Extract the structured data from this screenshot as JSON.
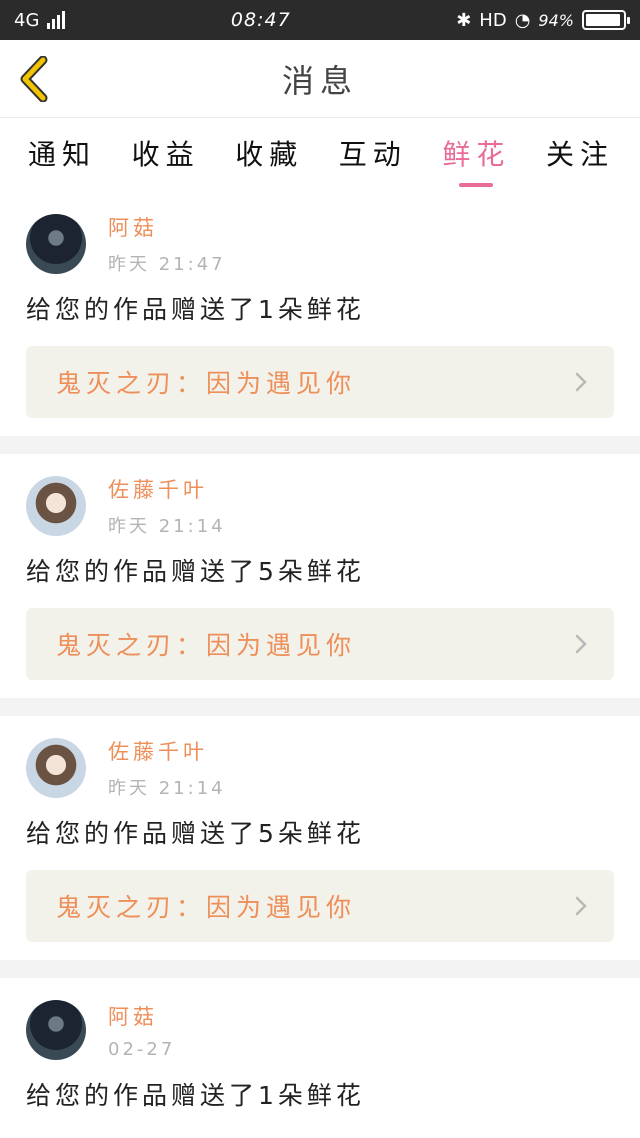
{
  "status": {
    "network": "4G",
    "time": "08:47",
    "hd": "HD",
    "battery_text": "94%",
    "battery_level": 0.94
  },
  "header": {
    "title": "消息"
  },
  "tabs": [
    {
      "label": "通知",
      "active": false
    },
    {
      "label": "收益",
      "active": false
    },
    {
      "label": "收藏",
      "active": false
    },
    {
      "label": "互动",
      "active": false
    },
    {
      "label": "鲜花",
      "active": true
    },
    {
      "label": "关注",
      "active": false
    }
  ],
  "messages": [
    {
      "user": "阿菇",
      "time": "昨天  21:47",
      "text": "给您的作品赠送了1朵鲜花",
      "work": "鬼灭之刃：因为遇见你",
      "avatar": "dark-hair-avatar"
    },
    {
      "user": "佐藤千叶",
      "time": "昨天  21:14",
      "text": "给您的作品赠送了5朵鲜花",
      "work": "鬼灭之刃：因为遇见你",
      "avatar": "light-hair-avatar"
    },
    {
      "user": "佐藤千叶",
      "time": "昨天  21:14",
      "text": "给您的作品赠送了5朵鲜花",
      "work": "鬼灭之刃：因为遇见你",
      "avatar": "light-hair-avatar"
    },
    {
      "user": "阿菇",
      "time": "02-27",
      "text": "给您的作品赠送了1朵鲜花",
      "avatar": "dark-hair-avatar"
    }
  ],
  "colors": {
    "accent": "#e86b98",
    "orange": "#ee8f5a",
    "back_arrow": "#f2c300"
  }
}
